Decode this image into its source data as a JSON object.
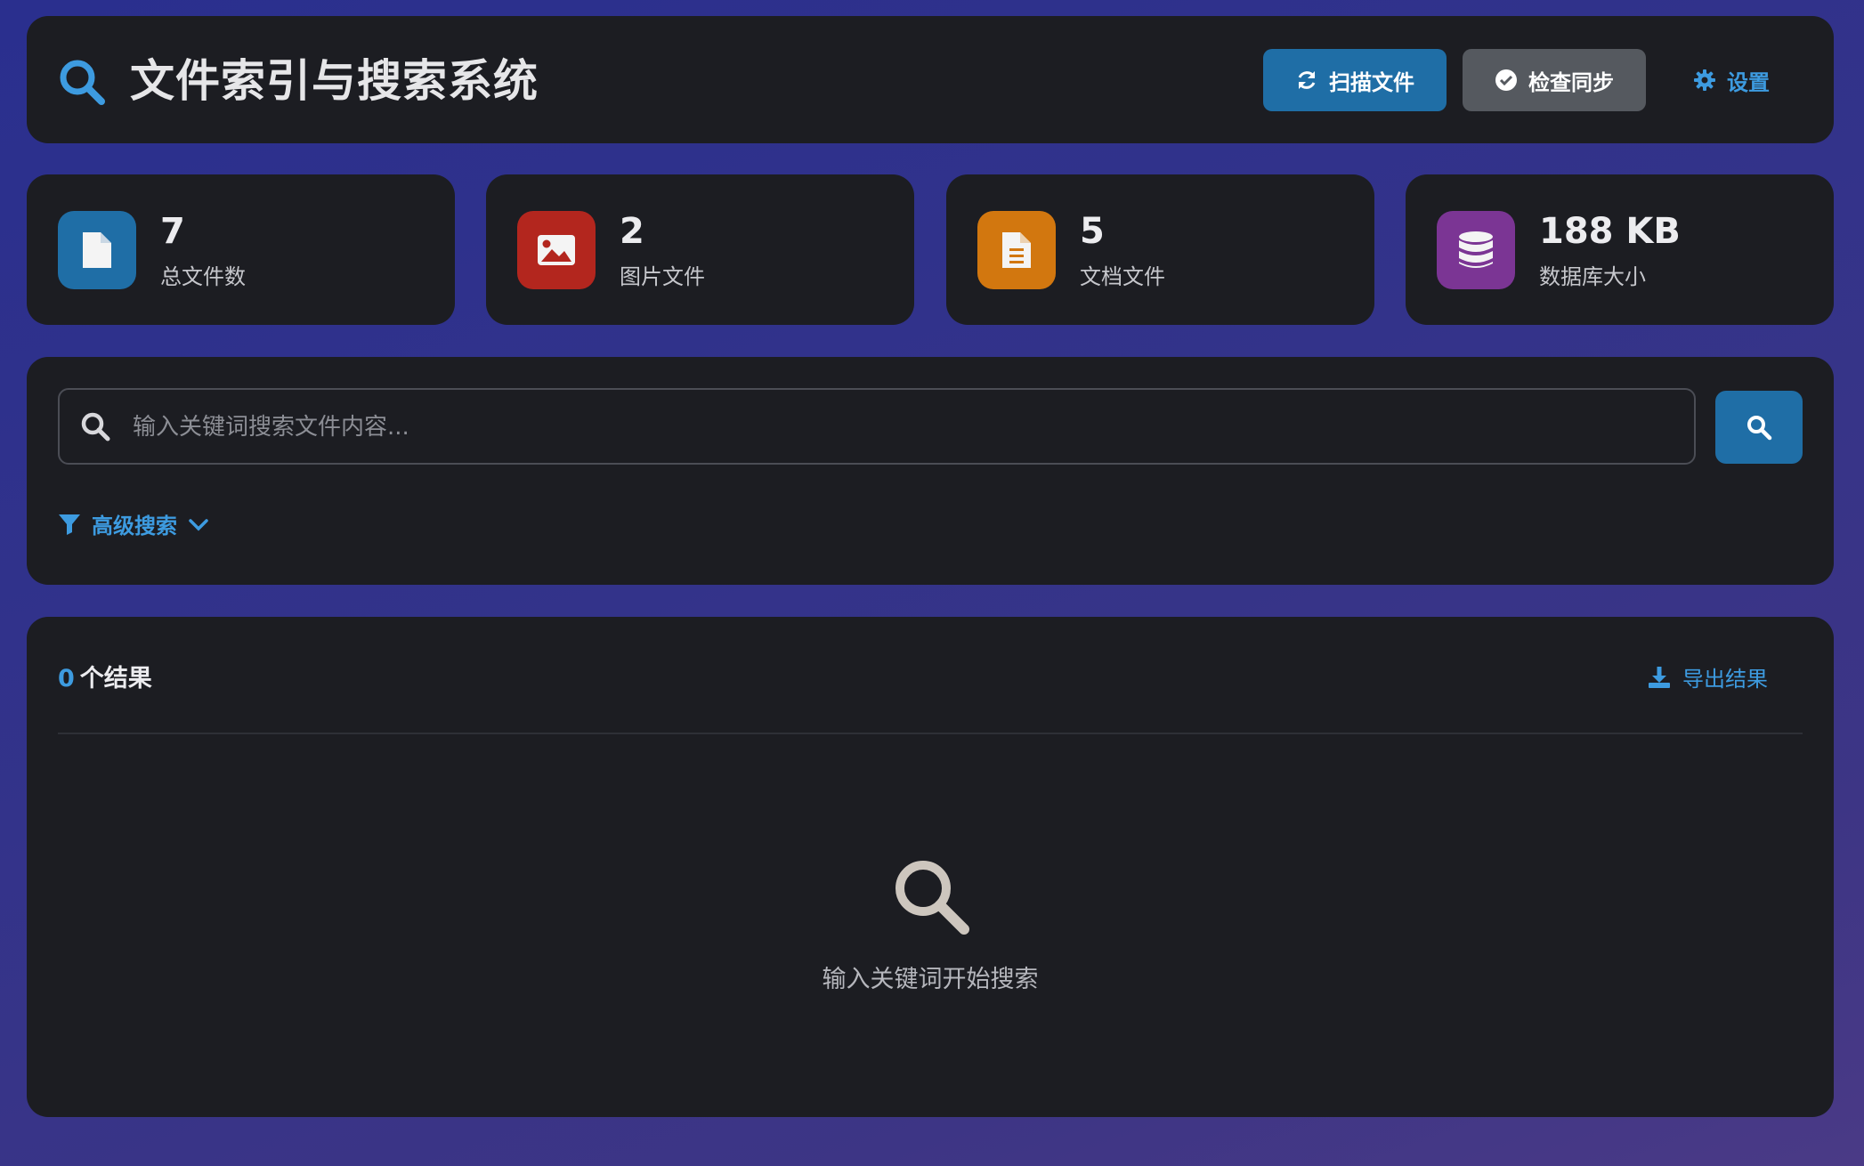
{
  "header": {
    "title": "文件索引与搜索系统",
    "scan_label": "扫描文件",
    "sync_label": "检查同步",
    "settings_label": "设置",
    "icon": "search-icon"
  },
  "stats": [
    {
      "value": "7",
      "label": "总文件数",
      "icon": "file-icon",
      "color": "#1f6ea6"
    },
    {
      "value": "2",
      "label": "图片文件",
      "icon": "image-icon",
      "color": "#b3261e"
    },
    {
      "value": "5",
      "label": "文档文件",
      "icon": "document-icon",
      "color": "#d2770f"
    },
    {
      "value": "188 KB",
      "label": "数据库大小",
      "icon": "database-icon",
      "color": "#7b3594"
    }
  ],
  "search": {
    "placeholder": "输入关键词搜索文件内容...",
    "advanced_label": "高级搜索"
  },
  "results": {
    "count": "0",
    "count_suffix": "个结果",
    "export_label": "导出结果",
    "empty_text": "输入关键词开始搜索"
  },
  "colors": {
    "accent": "#3d9be0",
    "primary_button": "#1f6ea6",
    "secondary_button": "#55595f",
    "panel": "#1c1d22"
  }
}
